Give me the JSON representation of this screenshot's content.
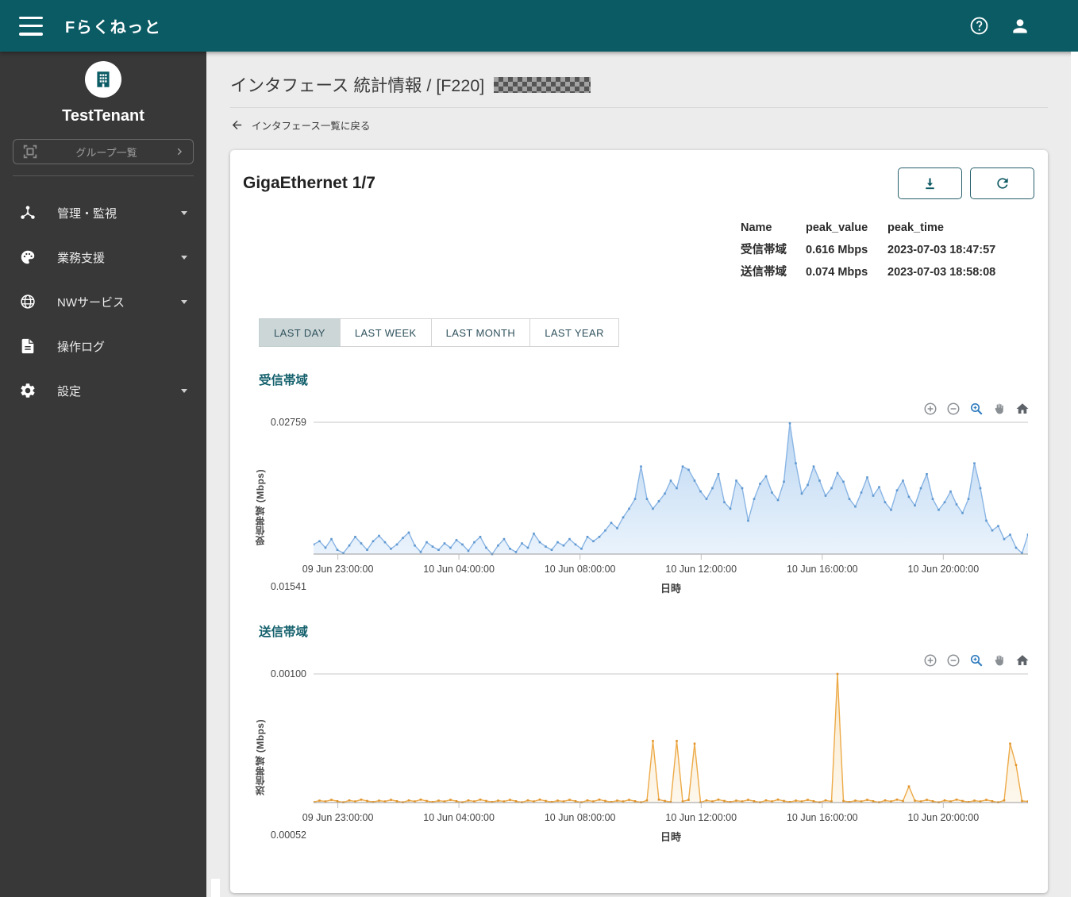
{
  "app": {
    "title": "Fらくねっと"
  },
  "sidebar": {
    "tenant_name": "TestTenant",
    "group_button_label": "グループ一覧",
    "items": [
      {
        "label": "管理・監視",
        "icon": "hub-icon",
        "expandable": true
      },
      {
        "label": "業務支援",
        "icon": "palette-icon",
        "expandable": true
      },
      {
        "label": "NWサービス",
        "icon": "globe-icon",
        "expandable": true
      },
      {
        "label": "操作ログ",
        "icon": "document-icon",
        "expandable": false
      },
      {
        "label": "設定",
        "icon": "gear-icon",
        "expandable": true
      }
    ]
  },
  "page": {
    "title": "インタフェース 統計情報 / [F220]",
    "title_redacted": true,
    "back_link": "インタフェース一覧に戻る"
  },
  "card": {
    "title": "GigaEthernet 1/7",
    "peak_table": {
      "headers": [
        "Name",
        "peak_value",
        "peak_time"
      ],
      "rows": [
        [
          "受信帯域",
          "0.616 Mbps",
          "2023-07-03 18:47:57"
        ],
        [
          "送信帯域",
          "0.074 Mbps",
          "2023-07-03 18:58:08"
        ]
      ]
    },
    "tabs": [
      {
        "label": "LAST DAY",
        "active": true
      },
      {
        "label": "LAST WEEK",
        "active": false
      },
      {
        "label": "LAST MONTH",
        "active": false
      },
      {
        "label": "LAST YEAR",
        "active": false
      }
    ]
  },
  "chart_toolbar": {
    "icons": [
      "zoom-in-icon",
      "zoom-out-icon",
      "box-zoom-icon",
      "pan-icon",
      "home-icon"
    ]
  },
  "colors": {
    "header_teal": "#0b5b64",
    "sidebar_bg": "#383838",
    "accent_teal": "#13606c",
    "tab_active_bg": "#ccd6d7",
    "receive_line": "#8ab5e4",
    "receive_marker": "#5e97d0",
    "transmit_line": "#edaa48",
    "transmit_marker": "#e1952e",
    "modebar_active": "#2f7cbe"
  },
  "chart_data": [
    {
      "type": "area",
      "title": "受信帯域",
      "ylabel": "受信帯域 (Mbps)",
      "xlabel": "日時",
      "ylim": [
        0.01541,
        0.02759
      ],
      "ytick_labels": [
        "0.02759",
        "0.01541"
      ],
      "xtick_labels": [
        "09 Jun 23:00:00",
        "10 Jun 04:00:00",
        "10 Jun 08:00:00",
        "10 Jun 12:00:00",
        "10 Jun 16:00:00",
        "10 Jun 20:00:00"
      ],
      "grid": "top-line-only",
      "line_color": "#8ab5e4",
      "marker_color": "#5e97d0",
      "fill_top": "#bcd7f2",
      "fill_bottom": "#eaf3fc",
      "values": [
        0.0163,
        0.0166,
        0.016,
        0.0168,
        0.0158,
        0.0155,
        0.0162,
        0.017,
        0.0164,
        0.0158,
        0.0166,
        0.0171,
        0.0165,
        0.0159,
        0.0163,
        0.0169,
        0.0174,
        0.0162,
        0.0156,
        0.0165,
        0.0161,
        0.0158,
        0.0164,
        0.016,
        0.0167,
        0.0163,
        0.0157,
        0.0165,
        0.017,
        0.016,
        0.0154,
        0.0162,
        0.0168,
        0.0159,
        0.0156,
        0.0164,
        0.016,
        0.0173,
        0.0165,
        0.0161,
        0.0158,
        0.0165,
        0.0162,
        0.0168,
        0.0163,
        0.0159,
        0.017,
        0.0166,
        0.017,
        0.0176,
        0.0183,
        0.0178,
        0.0188,
        0.0196,
        0.0205,
        0.0235,
        0.0205,
        0.0196,
        0.0203,
        0.021,
        0.0222,
        0.0215,
        0.0235,
        0.0232,
        0.0222,
        0.0212,
        0.0205,
        0.0215,
        0.0228,
        0.0202,
        0.0196,
        0.0222,
        0.0215,
        0.0185,
        0.0205,
        0.0219,
        0.0226,
        0.0211,
        0.0204,
        0.0221,
        0.0275,
        0.0238,
        0.021,
        0.0218,
        0.0235,
        0.0222,
        0.0208,
        0.0215,
        0.0229,
        0.0221,
        0.0205,
        0.0198,
        0.0211,
        0.0225,
        0.0208,
        0.0216,
        0.0202,
        0.0195,
        0.0213,
        0.0222,
        0.0207,
        0.0199,
        0.0215,
        0.0228,
        0.0205,
        0.0195,
        0.0202,
        0.0212,
        0.02,
        0.0192,
        0.0205,
        0.0238,
        0.0215,
        0.0185,
        0.0176,
        0.018,
        0.0168,
        0.0172,
        0.016,
        0.0155,
        0.0172
      ]
    },
    {
      "type": "area",
      "title": "送信帯域",
      "ylabel": "送信帯域 (Mbps)",
      "xlabel": "日時",
      "ylim": [
        0.00052,
        0.001
      ],
      "ytick_labels": [
        "0.00100",
        "0.00052"
      ],
      "xtick_labels": [
        "09 Jun 23:00:00",
        "10 Jun 04:00:00",
        "10 Jun 08:00:00",
        "10 Jun 12:00:00",
        "10 Jun 16:00:00",
        "10 Jun 20:00:00"
      ],
      "grid": "top-line-only",
      "line_color": "#edaa48",
      "marker_color": "#e1952e",
      "fill_top": "#f9e8c9",
      "fill_bottom": "#fdf7ec",
      "values": [
        0.000522,
        0.000527,
        0.000524,
        0.00053,
        0.000525,
        0.000521,
        0.000528,
        0.000524,
        0.000531,
        0.000526,
        0.000522,
        0.000527,
        0.000524,
        0.00053,
        0.000525,
        0.000521,
        0.000528,
        0.000524,
        0.000531,
        0.000526,
        0.000522,
        0.000527,
        0.000524,
        0.00053,
        0.000525,
        0.000521,
        0.000528,
        0.000524,
        0.000531,
        0.000526,
        0.000522,
        0.000527,
        0.000524,
        0.00053,
        0.000525,
        0.000521,
        0.000528,
        0.000524,
        0.000531,
        0.000526,
        0.000522,
        0.000527,
        0.000524,
        0.00053,
        0.000525,
        0.000521,
        0.000528,
        0.000524,
        0.000531,
        0.000526,
        0.000522,
        0.000527,
        0.000524,
        0.00053,
        0.000525,
        0.000521,
        0.000528,
        0.00075,
        0.000531,
        0.000526,
        0.000522,
        0.00075,
        0.000524,
        0.00053,
        0.00074,
        0.000521,
        0.000528,
        0.000524,
        0.000531,
        0.000526,
        0.000522,
        0.000527,
        0.000524,
        0.00053,
        0.000525,
        0.000521,
        0.000528,
        0.000524,
        0.000531,
        0.000526,
        0.000522,
        0.000527,
        0.000524,
        0.00053,
        0.000525,
        0.000521,
        0.000528,
        0.000524,
        0.001,
        0.000526,
        0.000522,
        0.000527,
        0.000524,
        0.00053,
        0.000525,
        0.000521,
        0.000528,
        0.000524,
        0.000531,
        0.000526,
        0.00058,
        0.000527,
        0.000524,
        0.00053,
        0.000525,
        0.000521,
        0.000528,
        0.000524,
        0.000531,
        0.000526,
        0.000522,
        0.000527,
        0.000524,
        0.00053,
        0.000525,
        0.000521,
        0.000528,
        0.00074,
        0.00066,
        0.000526,
        0.000524
      ]
    }
  ]
}
